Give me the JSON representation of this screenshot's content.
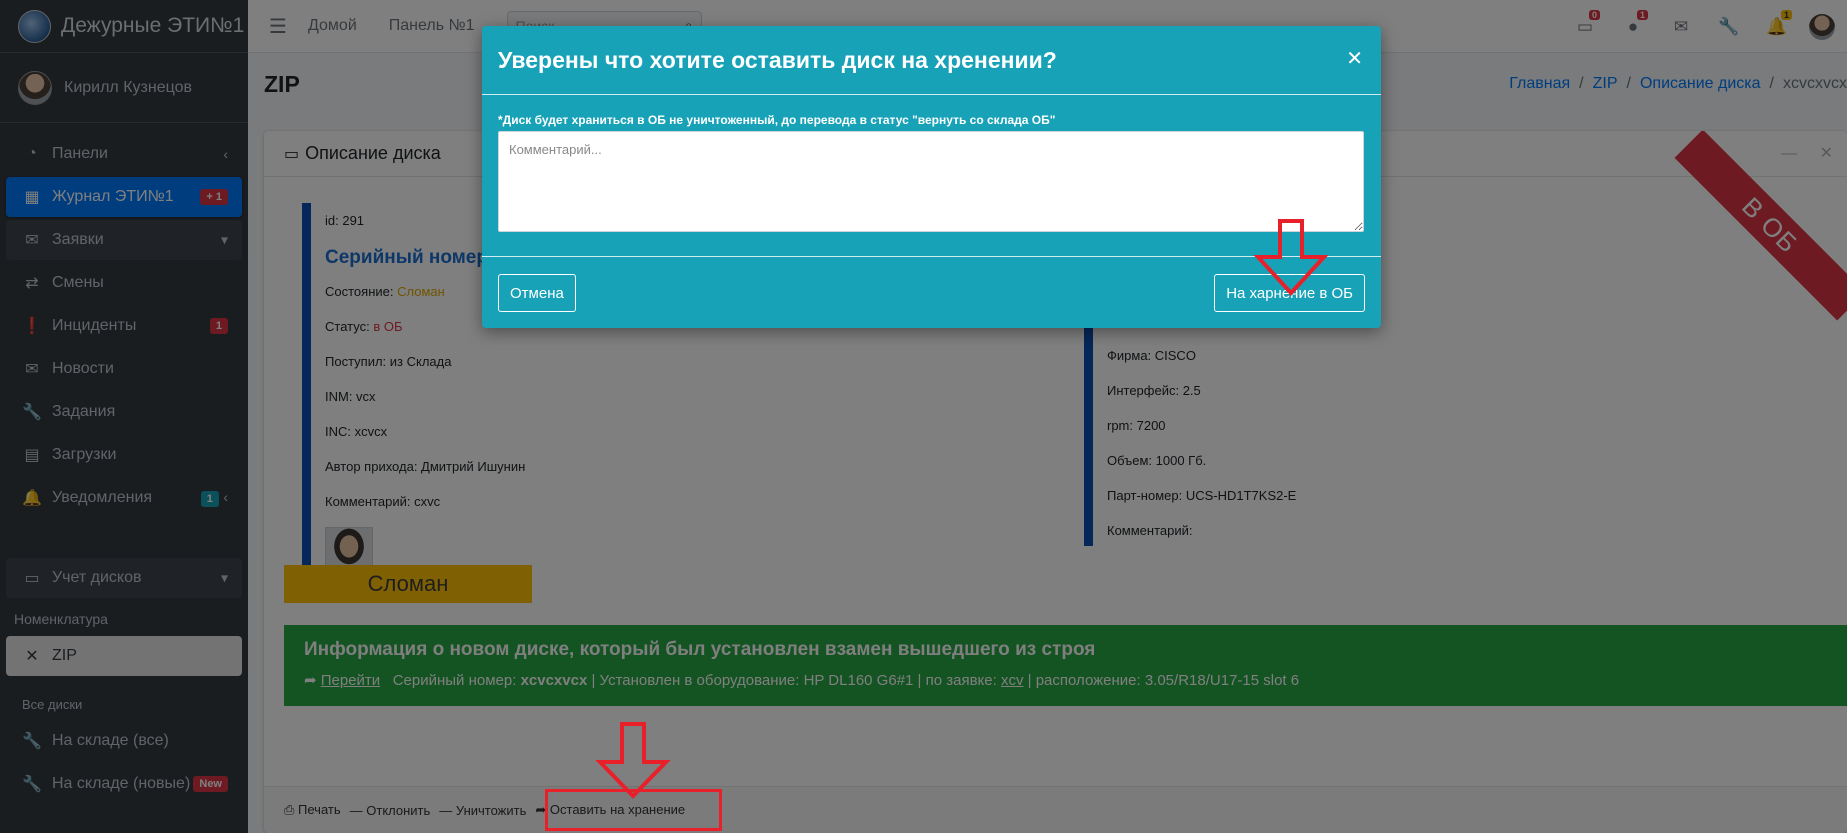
{
  "brand": {
    "title": "Дежурные ЭТИ№1",
    "logo_icon": "emblem-logo"
  },
  "user": {
    "name": "Кирилл Кузнецов"
  },
  "sidebar": {
    "items": [
      {
        "label": "Панели",
        "icon": "tachometer-icon",
        "right": "‹"
      },
      {
        "label": "Журнал ЭТИ№1",
        "icon": "grid-icon",
        "badge": "+ 1",
        "state": "active"
      },
      {
        "label": "Заявки",
        "icon": "envelope-icon",
        "right": "⌄",
        "state": "open"
      },
      {
        "label": "Смены",
        "icon": "exchange-icon"
      },
      {
        "label": "Инциденты",
        "icon": "exclamation-icon",
        "badge": "1"
      },
      {
        "label": "Новости",
        "icon": "envelope-open-icon"
      },
      {
        "label": "Задания",
        "icon": "wrench-icon"
      },
      {
        "label": "Загрузки",
        "icon": "file-icon"
      },
      {
        "label": "Уведомления",
        "icon": "bell-icon",
        "badge": "1",
        "right": "‹"
      }
    ],
    "disks": {
      "label": "Учет дисков",
      "icon": "hdd-icon",
      "right": "⌄"
    },
    "header_nomenclature": "Номенклатура",
    "zip": {
      "label": "ZIP",
      "icon": "compress-icon"
    },
    "header_all_disks": "Все диски",
    "warehouse_all": {
      "label": "На складе (все)",
      "icon": "wrench-icon"
    },
    "warehouse_new": {
      "label": "На складе (новые)",
      "icon": "wrench-icon",
      "badge": "New"
    }
  },
  "topbar": {
    "home": "Домой",
    "panel": "Панель №1",
    "search_placeholder": "Поиск",
    "badges": {
      "disks": "0",
      "incidents": "1",
      "notifications": "1"
    }
  },
  "page": {
    "title": "ZIP",
    "breadcrumb": [
      "Главная",
      "ZIP",
      "Описание диска",
      "xcvcxvcx"
    ]
  },
  "card": {
    "title": "Описание диска",
    "ribbon": "В ОБ",
    "left": {
      "id": "id: 291",
      "serial": "Серийный номер",
      "state_label": "Состояние: ",
      "state_value": "Сломан",
      "status_label": "Статус: ",
      "status_value": "в ОБ",
      "received": "Поступил: из Склада",
      "inm": "INM: vcx",
      "inc": "INC: xcvcx",
      "author": "Автор прихода: Дмитрий Ишунин",
      "comment": "Комментарий: cxvc"
    },
    "right": {
      "firm": "Фирма: CISCO",
      "interface": "Интерфейс: 2.5",
      "rpm": "rpm: 7200",
      "volume": "Объем: 1000 Гб.",
      "part": "Парт-номер: UCS-HD1T7KS2-E",
      "comment": "Комментарий:"
    },
    "status_box": "Сломан",
    "green": {
      "title": "Информация о новом диске, который был установлен взамен вышедшего из строя",
      "go": "Перейти",
      "serial_label": "Серийный номер: ",
      "serial_value": "xcvcxvcx",
      "installed": " | Установлен в оборудование: HP DL160 G6#1 | по заявке: ",
      "request": "xcv",
      "location": " | расположение: 3.05/R18/U17-15 slot 6"
    },
    "footer": {
      "print": "Печать",
      "reject": "Отклонить",
      "destroy": "Уничтожить",
      "store": "Оставить на хранение"
    }
  },
  "modal": {
    "title": "Уверены что хотите оставить диск на хренении?",
    "note": "*Диск будет храниться в ОБ не уничтоженный, до перевода в статус \"вернуть со склада ОБ\"",
    "placeholder": "Комментарий...",
    "cancel": "Отмена",
    "confirm": "На харнение в ОБ"
  },
  "colors": {
    "accent": "#007bff",
    "modal": "#17a2b8",
    "success": "#28a745",
    "warning": "#ffc107",
    "danger": "#dc3545",
    "annotation": "#e8202a"
  }
}
